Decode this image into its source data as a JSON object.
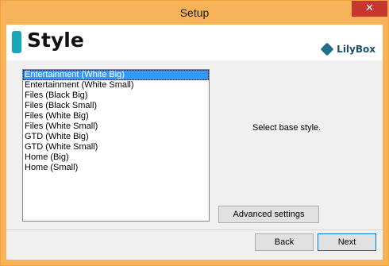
{
  "window": {
    "title": "Setup",
    "close_glyph": "✕"
  },
  "header": {
    "title": "Style",
    "logo_icon": "lilybox-logo-icon",
    "logo_text": "LilyBox"
  },
  "style_list": {
    "selected_index": 0,
    "items": [
      {
        "label": "Entertainment (White Big)"
      },
      {
        "label": "Entertainment (White Small)"
      },
      {
        "label": "Files (Black Big)"
      },
      {
        "label": "Files (Black Small)"
      },
      {
        "label": "Files (White Big)"
      },
      {
        "label": "Files (White Small)"
      },
      {
        "label": "GTD (White Big)"
      },
      {
        "label": "GTD (White Small)"
      },
      {
        "label": "Home (Big)"
      },
      {
        "label": "Home (Small)"
      }
    ]
  },
  "description": "Select base style.",
  "buttons": {
    "advanced": "Advanced settings",
    "back": "Back",
    "next": "Next"
  },
  "colors": {
    "title_bar": "#f6b35a",
    "close_button": "#c7372f",
    "accent": "#17a7b6",
    "selection": "#3399ff"
  }
}
